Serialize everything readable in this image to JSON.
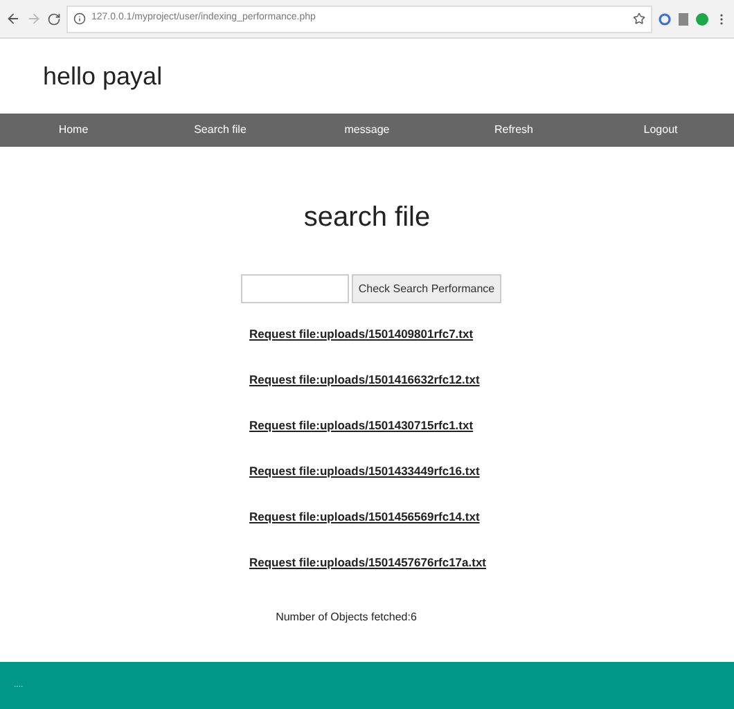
{
  "browser": {
    "url": "127.0.0.1/myproject/user/indexing_performance.php"
  },
  "greeting": "hello payal",
  "nav": [
    {
      "label": "Home"
    },
    {
      "label": "Search file"
    },
    {
      "label": "message"
    },
    {
      "label": "Refresh"
    },
    {
      "label": "Logout"
    }
  ],
  "heading": "search file",
  "search": {
    "button": "Check Search Performance"
  },
  "links": [
    "Request file:uploads/1501409801rfc7.txt",
    "Request file:uploads/1501416632rfc12.txt",
    "Request file:uploads/1501430715rfc1.txt",
    "Request file:uploads/1501433449rfc16.txt",
    "Request file:uploads/1501456569rfc14.txt",
    "Request file:uploads/1501457676rfc17a.txt"
  ],
  "count": "Number of Objects fetched:6",
  "footer": "...."
}
